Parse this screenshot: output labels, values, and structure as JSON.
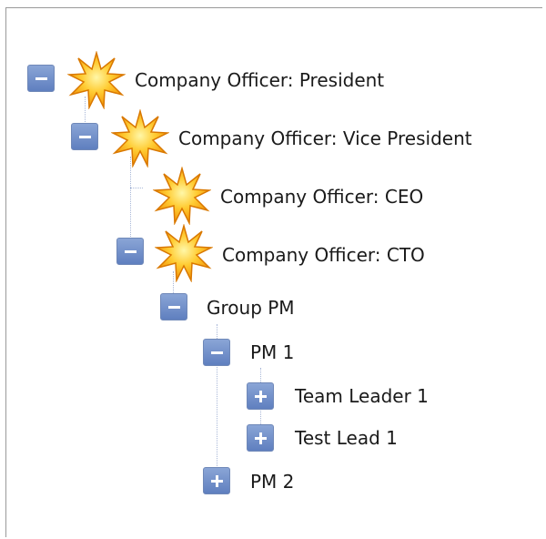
{
  "tree": {
    "nodes": [
      {
        "label": "Company Officer: President",
        "expanded": true,
        "icon": "starburst-icon"
      },
      {
        "label": "Company Officer: Vice President",
        "expanded": true,
        "icon": "starburst-icon"
      },
      {
        "label": "Company Officer: CEO",
        "icon": "starburst-icon"
      },
      {
        "label": "Company Officer: CTO",
        "expanded": true,
        "icon": "starburst-icon"
      },
      {
        "label": "Group PM",
        "expanded": true
      },
      {
        "label": "PM 1",
        "expanded": true
      },
      {
        "label": "Team Leader 1",
        "expanded": false
      },
      {
        "label": "Test Lead 1",
        "expanded": false
      },
      {
        "label": "PM 2",
        "expanded": false
      }
    ]
  }
}
